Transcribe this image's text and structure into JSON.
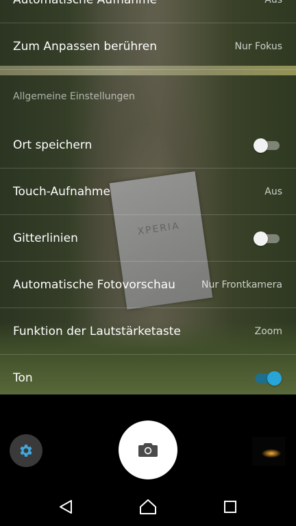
{
  "settings": {
    "rows": [
      {
        "label": "Automatische Aufnahme",
        "value": "Aus"
      },
      {
        "label": "Zum Anpassen berühren",
        "value": "Nur Fokus"
      },
      {
        "label": "Ort speichern",
        "toggle": false
      },
      {
        "label": "Touch-Aufnahme",
        "value": "Aus"
      },
      {
        "label": "Gitterlinien",
        "toggle": false
      },
      {
        "label": "Automatische Fotovorschau",
        "value": "Nur Frontkamera"
      },
      {
        "label": "Funktion der Lautstärketaste",
        "value": "Zoom"
      },
      {
        "label": "Ton",
        "toggle": true
      }
    ],
    "section_header": "Allgemeine Einstellungen"
  },
  "preview": {
    "box_text": "XPERIA"
  },
  "controls": {
    "settings_icon": "gear-icon",
    "shutter_icon": "camera-icon",
    "accent_color": "#28a5d8"
  },
  "navbar": {
    "back_icon": "back-triangle-icon",
    "home_icon": "home-icon",
    "recents_icon": "recents-square-icon"
  }
}
